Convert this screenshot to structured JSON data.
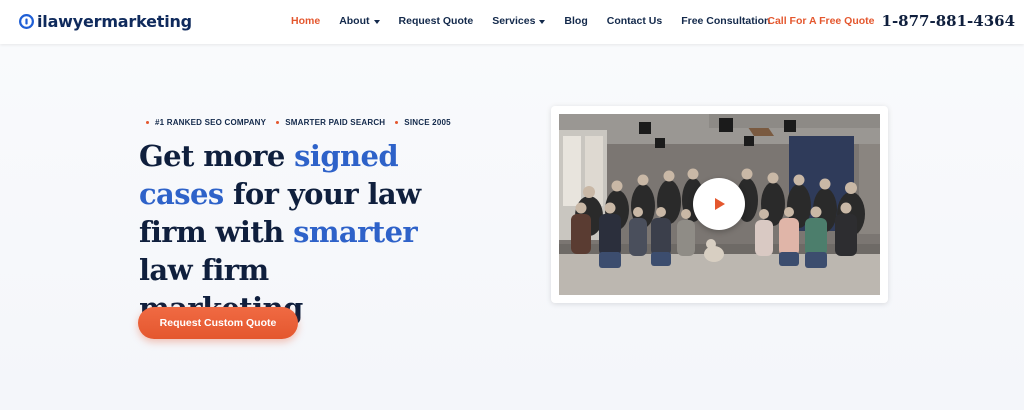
{
  "brand": {
    "logo_text": "ilawyermarketing"
  },
  "nav": {
    "items": [
      {
        "label": "Home",
        "active": true,
        "dropdown": false
      },
      {
        "label": "About",
        "active": false,
        "dropdown": true
      },
      {
        "label": "Request Quote",
        "active": false,
        "dropdown": false
      },
      {
        "label": "Services",
        "active": false,
        "dropdown": true
      },
      {
        "label": "Blog",
        "active": false,
        "dropdown": false
      },
      {
        "label": "Contact Us",
        "active": false,
        "dropdown": false
      },
      {
        "label": "Free Consultation",
        "active": false,
        "dropdown": false
      }
    ]
  },
  "call": {
    "label": "Call For A Free Quote",
    "phone": "1-877-881-4364"
  },
  "hero": {
    "tags": [
      "#1 RANKED SEO COMPANY",
      "SMARTER PAID SEARCH",
      "SINCE 2005"
    ],
    "headline": {
      "p1": "Get more ",
      "h1": "signed cases",
      "p2": " for your law firm with ",
      "h2": "smarter",
      "p3": " law firm marketing"
    },
    "cta_label": "Request Custom Quote"
  },
  "video": {
    "play_icon": "play-icon"
  },
  "colors": {
    "accent": "#e4572e",
    "navy": "#0f1f3d",
    "highlight_blue": "#2e62c9"
  }
}
